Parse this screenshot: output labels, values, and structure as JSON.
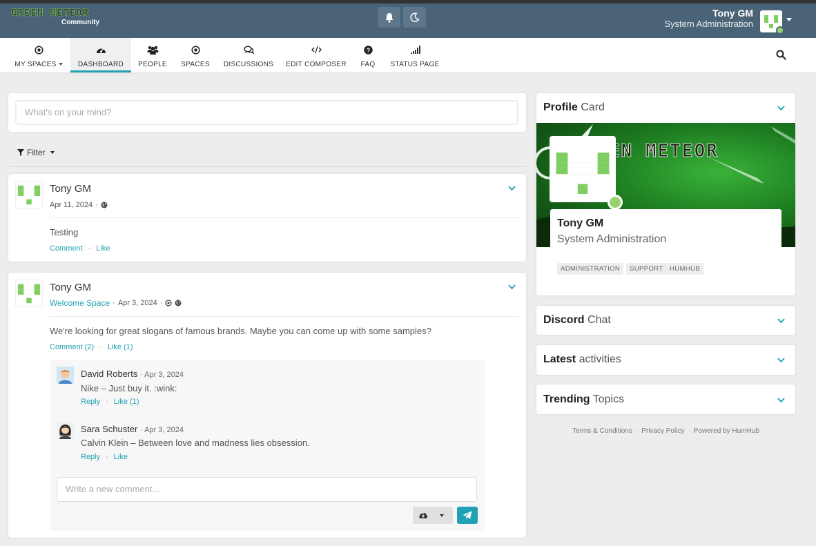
{
  "header": {
    "logo_text": "GREEN METEOR",
    "logo_subtitle": "Community",
    "user_name": "Tony GM",
    "user_role": "System Administration"
  },
  "nav": {
    "items": [
      {
        "label": "MY SPACES",
        "icon": "dot-circle-icon"
      },
      {
        "label": "DASHBOARD",
        "icon": "dashboard-icon"
      },
      {
        "label": "PEOPLE",
        "icon": "users-icon"
      },
      {
        "label": "SPACES",
        "icon": "dot-circle-icon"
      },
      {
        "label": "DISCUSSIONS",
        "icon": "comments-icon"
      },
      {
        "label": "EDIT COMPOSER",
        "icon": "code-icon"
      },
      {
        "label": "FAQ",
        "icon": "question-circle-icon"
      },
      {
        "label": "STATUS PAGE",
        "icon": "signal-icon"
      }
    ]
  },
  "composer": {
    "placeholder": "What's on your mind?"
  },
  "filter": {
    "label": "Filter"
  },
  "posts": [
    {
      "author": "Tony GM",
      "date": "Apr 11, 2024",
      "text": "Testing",
      "comment_label": "Comment",
      "like_label": "Like"
    },
    {
      "author": "Tony GM",
      "space": "Welcome Space",
      "date": "Apr 3, 2024",
      "text": "We're looking for great slogans of famous brands. Maybe you can come up with some samples?",
      "comment_label": "Comment (2)",
      "like_label": "Like (1)",
      "comments": [
        {
          "author": "David Roberts",
          "date": "Apr 3, 2024",
          "text": "Nike – Just buy it. :wink:",
          "reply_label": "Reply",
          "like_label": "Like (1)"
        },
        {
          "author": "Sara Schuster",
          "date": "Apr 3, 2024",
          "text": "Calvin Klein – Between love and madness lies obsession.",
          "reply_label": "Reply",
          "like_label": "Like"
        }
      ],
      "comment_placeholder": "Write a new comment..."
    }
  ],
  "sidebar": {
    "profile": {
      "title_bold": "Profile",
      "title_rest": "Card",
      "banner_text": "EN METEOR",
      "name": "Tony GM",
      "role": "System Administration",
      "tags": [
        "ADMINISTRATION",
        "SUPPORT",
        "HUMHUB"
      ]
    },
    "discord": {
      "title_bold": "Discord",
      "title_rest": "Chat"
    },
    "latest": {
      "title_bold": "Latest",
      "title_rest": "activities"
    },
    "trending": {
      "title_bold": "Trending",
      "title_rest": "Topics"
    },
    "footer": {
      "terms": "Terms & Conditions",
      "privacy": "Privacy Policy",
      "powered": "Powered by HumHub"
    }
  },
  "colors": {
    "topbar": "#4a6377",
    "accent": "#21a1b3",
    "online": "#97d271",
    "avatar_green": "#7fce62"
  }
}
